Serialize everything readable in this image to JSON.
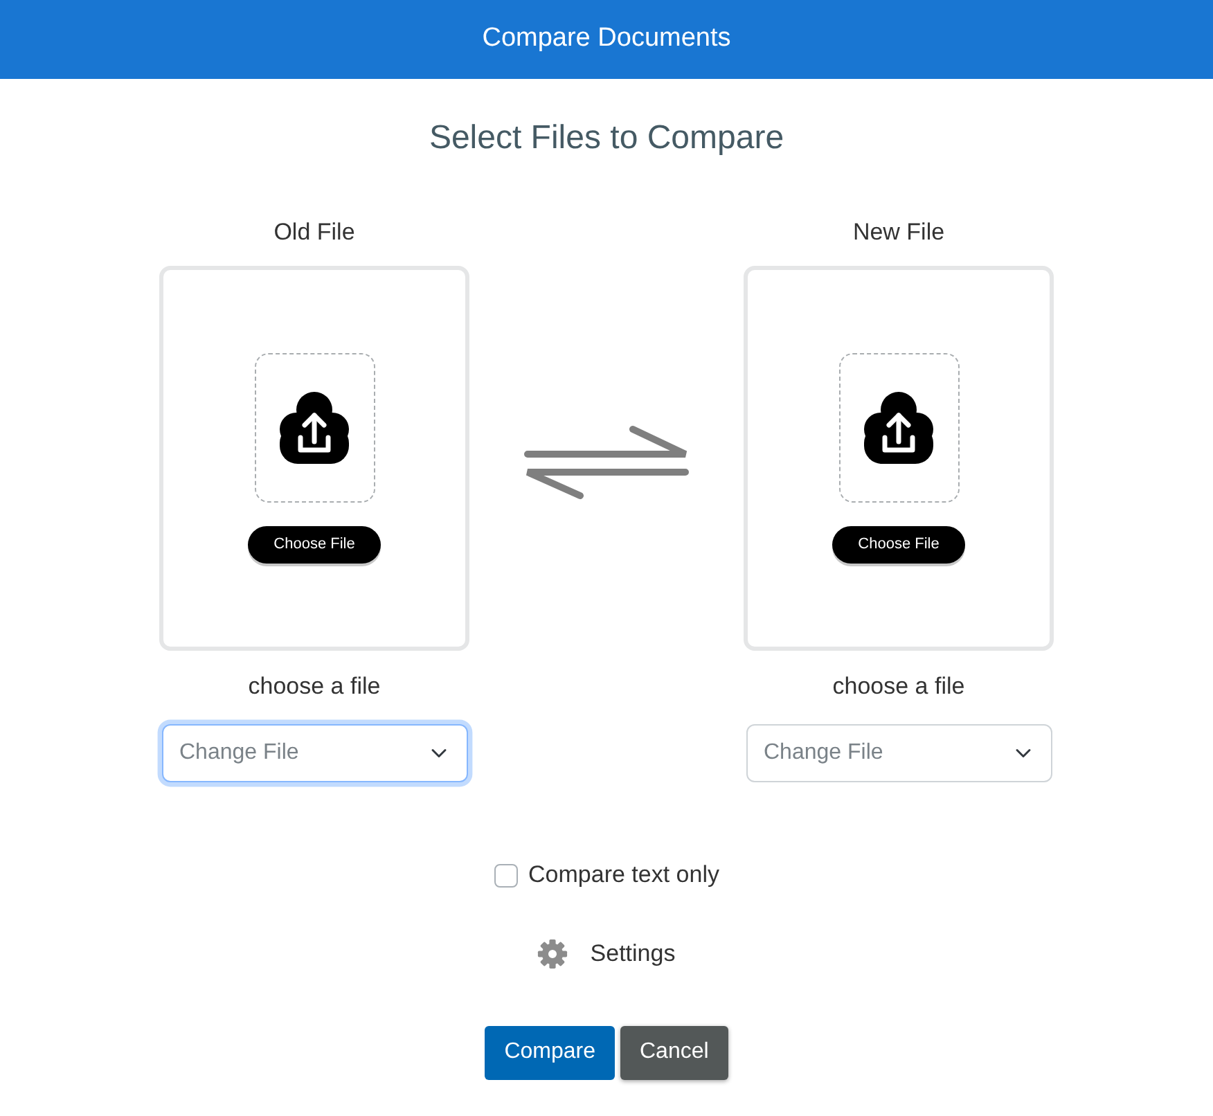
{
  "header": {
    "title": "Compare Documents"
  },
  "heading": "Select Files to Compare",
  "files": [
    {
      "label": "Old File",
      "upload_button": "Choose File",
      "caption": "choose a file",
      "select": {
        "placeholder": "Change File",
        "focused": true
      }
    },
    {
      "label": "New File",
      "upload_button": "Choose File",
      "caption": "choose a file",
      "select": {
        "placeholder": "Change File",
        "focused": false
      }
    }
  ],
  "options": [
    {
      "kind": "checkbox",
      "label": "Compare text only",
      "checked": false
    },
    {
      "kind": "settings",
      "label": "Settings"
    }
  ],
  "buttons": [
    {
      "label": "Compare",
      "kind": "primary"
    },
    {
      "label": "Cancel",
      "kind": "secondary"
    }
  ]
}
